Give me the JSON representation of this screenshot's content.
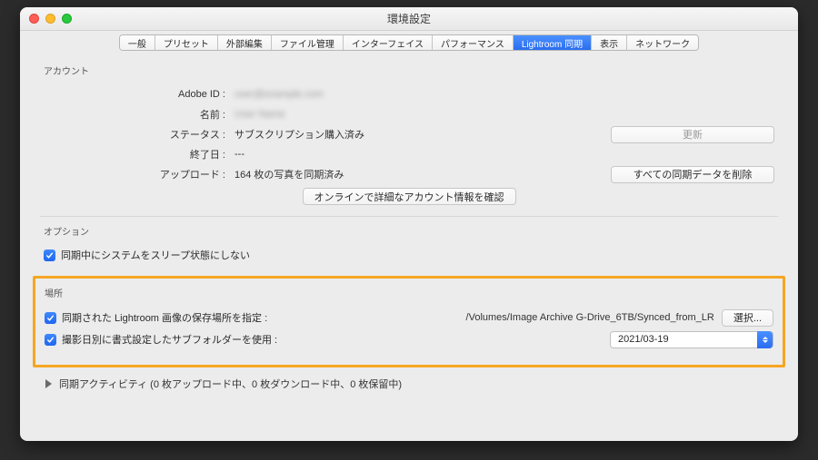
{
  "window": {
    "title": "環境設定"
  },
  "tabs": {
    "items": [
      "一般",
      "プリセット",
      "外部編集",
      "ファイル管理",
      "インターフェイス",
      "パフォーマンス",
      "Lightroom 同期",
      "表示",
      "ネットワーク"
    ],
    "activeIndex": 6
  },
  "account": {
    "section": "アカウント",
    "labels": {
      "adobeId": "Adobe ID :",
      "name": "名前 :",
      "status": "ステータス :",
      "endDate": "終了日 :",
      "upload": "アップロード :"
    },
    "values": {
      "adobeId": "user@example.com",
      "name": "User Name",
      "status": "サブスクリプション購入済み",
      "endDate": "---",
      "upload": "164 枚の写真を同期済み"
    },
    "buttons": {
      "update": "更新",
      "deleteAll": "すべての同期データを削除",
      "onlineInfo": "オンラインで詳細なアカウント情報を確認"
    }
  },
  "options": {
    "section": "オプション",
    "preventSleep": "同期中にシステムをスリープ状態にしない"
  },
  "location": {
    "section": "場所",
    "specifyLabel": "同期された Lightroom 画像の保存場所を指定 :",
    "path": "/Volumes/Image Archive G-Drive_6TB/Synced_from_LR",
    "chooseBtn": "選択...",
    "subfolderLabel": "撮影日別に書式設定したサブフォルダーを使用 :",
    "subfolderValue": "2021/03-19"
  },
  "activity": {
    "label": "同期アクティビティ (0 枚アップロード中、0 枚ダウンロード中、0 枚保留中)"
  }
}
